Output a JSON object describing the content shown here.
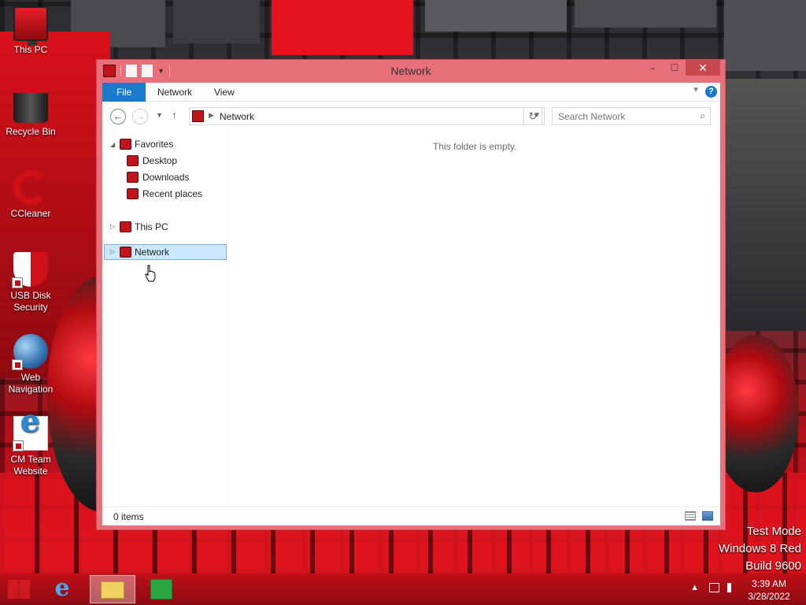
{
  "desktop": {
    "icons": [
      {
        "label": "This PC",
        "icon": "monitor-icon"
      },
      {
        "label": "Recycle Bin",
        "icon": "recycle-bin-icon"
      },
      {
        "label": "CCleaner",
        "icon": "ccleaner-icon"
      },
      {
        "label": "USB Disk Security",
        "icon": "shield-icon"
      },
      {
        "label": "Web Navigation",
        "icon": "globe-icon"
      },
      {
        "label": "CM Team Website",
        "icon": "internet-explorer-icon"
      }
    ],
    "watermark": [
      "Test Mode",
      "Windows 8 Red",
      "Build 9600"
    ]
  },
  "window": {
    "title": "Network",
    "controls": {
      "minimize": "–",
      "maximize": "☐",
      "close": "✕"
    },
    "ribbon": {
      "tabs": [
        "File",
        "Network",
        "View"
      ],
      "help": "?"
    },
    "nav": {
      "back": "←",
      "forward": "→",
      "up": "↑",
      "address": "Network",
      "refresh": "↻",
      "search_placeholder": "Search Network",
      "search_icon": "⌕"
    },
    "tree": {
      "favorites": "Favorites",
      "desktop": "Desktop",
      "downloads": "Downloads",
      "recent": "Recent places",
      "this_pc": "This PC",
      "network": "Network"
    },
    "empty_message": "This folder is empty.",
    "status": {
      "items": "0 items"
    }
  },
  "taskbar": {
    "time": "3:39 AM",
    "date": "3/28/2022",
    "ie_glyph": "e",
    "tray_up": "▲"
  },
  "colors": {
    "accent": "#1979ca",
    "titlebar": "#e8707a",
    "taskbar": "#c01018",
    "selection": "#cce8ff"
  }
}
